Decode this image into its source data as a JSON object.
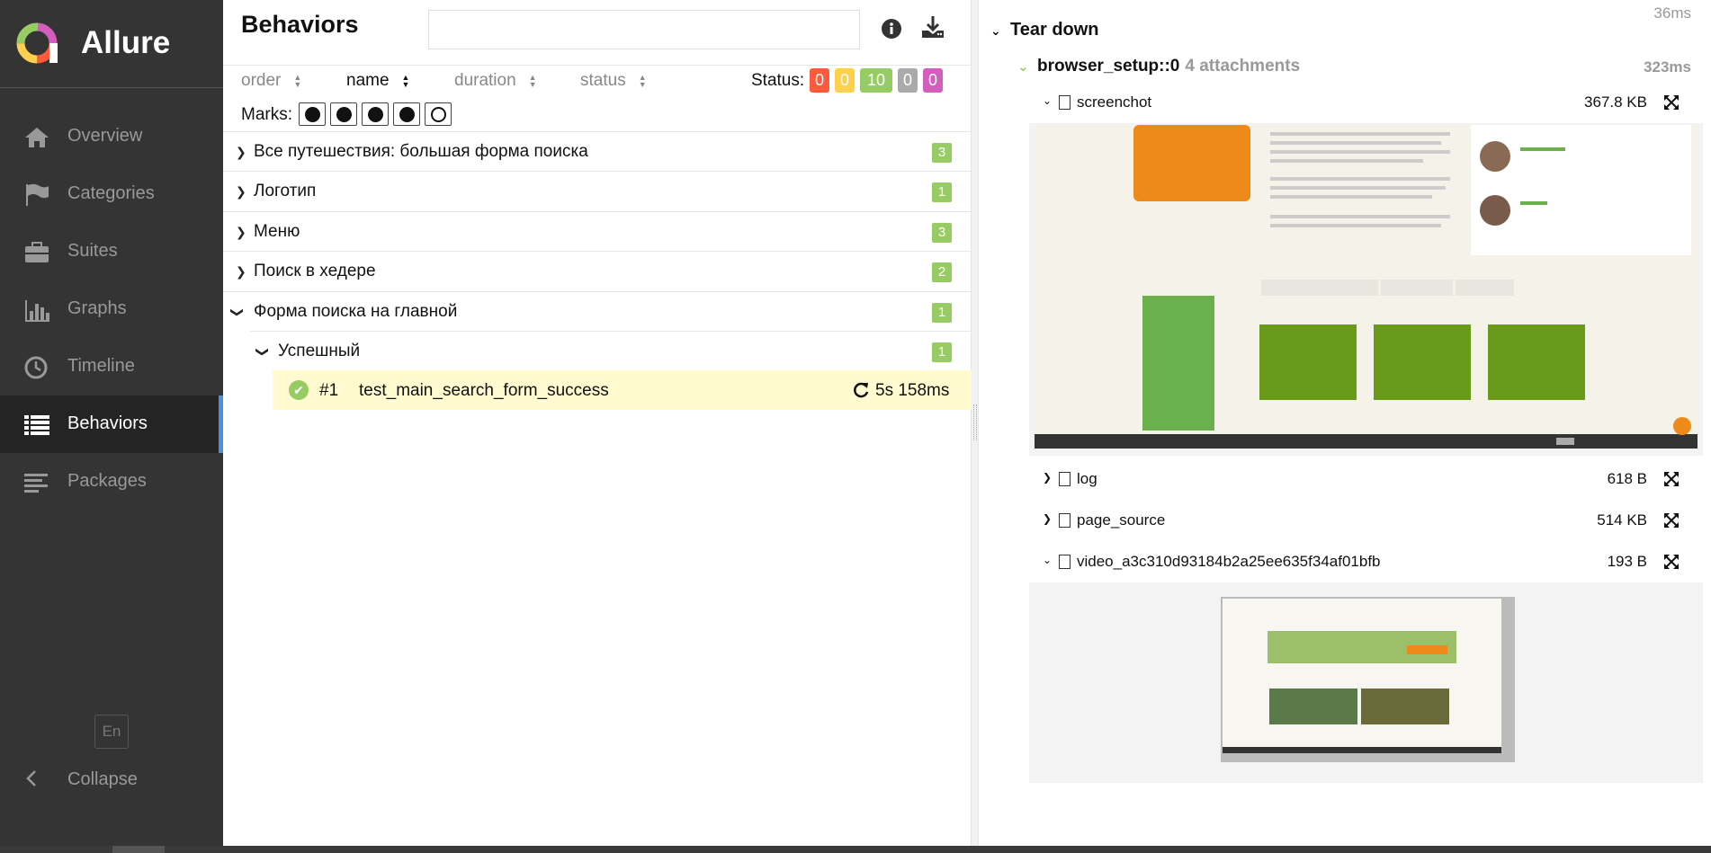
{
  "sidebar": {
    "brand": "Allure",
    "items": [
      {
        "label": "Overview",
        "icon": "home-icon"
      },
      {
        "label": "Categories",
        "icon": "flag-icon"
      },
      {
        "label": "Suites",
        "icon": "briefcase-icon"
      },
      {
        "label": "Graphs",
        "icon": "bar-chart-icon"
      },
      {
        "label": "Timeline",
        "icon": "clock-icon"
      },
      {
        "label": "Behaviors",
        "icon": "list-icon",
        "active": true
      },
      {
        "label": "Packages",
        "icon": "align-left-icon"
      }
    ],
    "language": "En",
    "collapse": "Collapse"
  },
  "behaviors": {
    "title": "Behaviors",
    "search_placeholder": "",
    "sort": [
      "order",
      "name",
      "duration",
      "status"
    ],
    "active_sort": "name",
    "status_label": "Status:",
    "status_counts": [
      {
        "value": "0",
        "color": "#fd5a3e"
      },
      {
        "value": "0",
        "color": "#ffd050"
      },
      {
        "value": "10",
        "color": "#97cc64"
      },
      {
        "value": "0",
        "color": "#aaaaaa"
      },
      {
        "value": "0",
        "color": "#d35ebe"
      }
    ],
    "marks_label": "Marks:",
    "marks": [
      "bomb-icon",
      "times-circle-icon",
      "check-circle-icon",
      "exclamation-circle-icon",
      "refresh-icon"
    ],
    "groups": [
      {
        "label": "Все путешествия: большая форма поиска",
        "count": "3"
      },
      {
        "label": "Логотип",
        "count": "1"
      },
      {
        "label": "Меню",
        "count": "3"
      },
      {
        "label": "Поиск в хедере",
        "count": "2"
      },
      {
        "label": "Форма поиска на главной",
        "count": "1"
      },
      {
        "label": "Успешный",
        "count": "1"
      }
    ],
    "test": {
      "number": "#1",
      "name": "test_main_search_form_success",
      "duration": "5s 158ms"
    }
  },
  "details": {
    "top_time": "36ms",
    "section": "Tear down",
    "step": "browser_setup::0",
    "step_attachments": "4 attachments",
    "step_time": "323ms",
    "attachments": [
      {
        "label": "screenchot",
        "size": "367.8 KB"
      },
      {
        "label": "log",
        "size": "618 B"
      },
      {
        "label": "page_source",
        "size": "514 KB"
      },
      {
        "label": "video_a3c310d93184b2a25ee635f34af01bfb",
        "size": "193 B"
      }
    ]
  },
  "colors": {
    "sidebar": "#343434",
    "accent": "#4a90e2",
    "passed": "#97cc64",
    "selected_row": "#fffacf"
  }
}
